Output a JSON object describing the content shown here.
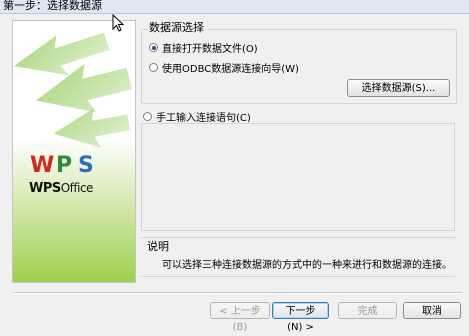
{
  "window": {
    "title": "第一步：选择数据源"
  },
  "data_source_group": {
    "label": "数据源选择",
    "option_open_file": "直接打开数据文件(O)",
    "option_odbc": "使用ODBC数据源连接向导(W)",
    "select_button": "选择数据源(S)..."
  },
  "manual": {
    "option_label": "手工输入连接语句(C)"
  },
  "description": {
    "title": "说明",
    "text": "可以选择三种连接数据源的方式中的一种来进行和数据源的连接。"
  },
  "sidebar": {
    "logo_wps_letters": [
      "W",
      "P",
      "S"
    ],
    "logo_office_prefix": "WPS",
    "logo_office_suffix": "Office"
  },
  "footer": {
    "prev_button": "< 上一步(B)",
    "next_button": "下一步(N) >",
    "finish_button": "完成",
    "cancel_button": "取消"
  },
  "state": {
    "selected_option": "open_file"
  },
  "colors": {
    "accent_green": "#7cc13b",
    "wps_w": "#d6261c",
    "wps_p": "#2d8c3a",
    "wps_s": "#2a6fc0"
  }
}
